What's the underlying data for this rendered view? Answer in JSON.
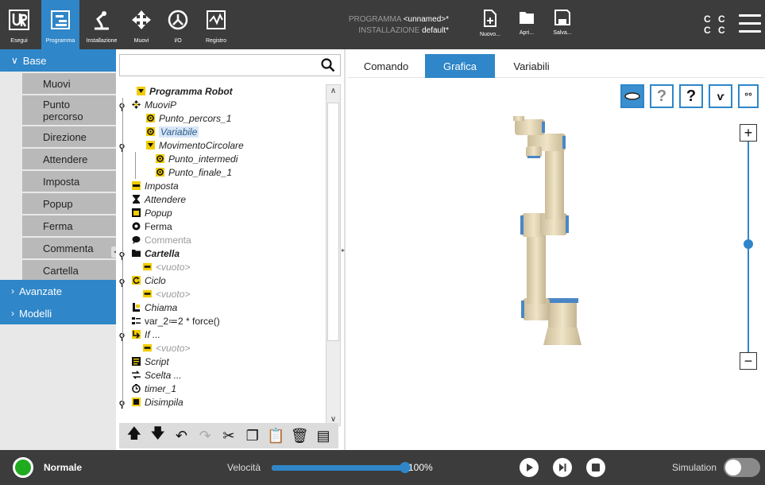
{
  "topbar": {
    "nav": [
      {
        "label": "Esegui",
        "icon": "ur-logo-icon"
      },
      {
        "label": "Programma",
        "icon": "program-tree-icon"
      },
      {
        "label": "Installazione",
        "icon": "robot-arm-icon"
      },
      {
        "label": "Muovi",
        "icon": "move-arrows-icon"
      },
      {
        "label": "I/O",
        "icon": "io-icon"
      },
      {
        "label": "Registro",
        "icon": "log-icon"
      }
    ],
    "program_key": "PROGRAMMA",
    "program_value": "<unnamed>*",
    "installation_key": "INSTALLAZIONE",
    "installation_value": "default*",
    "file_buttons": [
      {
        "label": "Nuovo...",
        "icon": "new-file-icon"
      },
      {
        "label": "Apri...",
        "icon": "folder-icon"
      },
      {
        "label": "Salva...",
        "icon": "save-icon"
      }
    ],
    "cc_line1": "C C",
    "cc_line2": "C C",
    "accent": "#2f86c8"
  },
  "palette": {
    "base_label": "Base",
    "items": [
      "Muovi",
      "Punto percorso",
      "Direzione",
      "Attendere",
      "Imposta",
      "Popup",
      "Ferma",
      "Commenta",
      "Cartella"
    ],
    "advanced_label": "Avanzate",
    "models_label": "Modelli"
  },
  "tree": {
    "search_placeholder": "",
    "nodes": [
      {
        "text": "Programma Robot",
        "icon": "flag-icon",
        "style": "bold it"
      },
      {
        "text": "MuoviP",
        "icon": "move-icon",
        "style": "it"
      },
      {
        "text": "Punto_percors_1",
        "icon": "waypoint-icon",
        "style": "it"
      },
      {
        "text": "Variabile",
        "icon": "waypoint-icon",
        "style": "it sel"
      },
      {
        "text": "MovimentoCircolare",
        "icon": "flag-icon",
        "style": "it"
      },
      {
        "text": "Punto_intermedi",
        "icon": "waypoint-icon",
        "style": "it"
      },
      {
        "text": "Punto_finale_1",
        "icon": "waypoint-icon",
        "style": "it"
      },
      {
        "text": "Imposta",
        "icon": "set-icon",
        "style": "it"
      },
      {
        "text": "Attendere",
        "icon": "hourglass-icon",
        "style": "it"
      },
      {
        "text": "Popup",
        "icon": "popup-icon",
        "style": "it"
      },
      {
        "text": "Ferma",
        "icon": "stop-icon",
        "style": ""
      },
      {
        "text": "Commenta",
        "icon": "comment-icon",
        "style": "gray"
      },
      {
        "text": "Cartella",
        "icon": "folder-icon",
        "style": "bold it"
      },
      {
        "text": "<vuoto>",
        "icon": "empty-icon",
        "style": "it gray"
      },
      {
        "text": "Ciclo",
        "icon": "loop-icon",
        "style": "it"
      },
      {
        "text": "<vuoto>",
        "icon": "empty-icon",
        "style": "it gray"
      },
      {
        "text": "Chiama",
        "icon": "call-icon",
        "style": "it"
      },
      {
        "text": "var_2≔2 * force()",
        "icon": "assignment-icon",
        "style": ""
      },
      {
        "text": "If ...",
        "icon": "if-icon",
        "style": "it"
      },
      {
        "text": "<vuoto>",
        "icon": "empty-icon",
        "style": "it gray"
      },
      {
        "text": "Script",
        "icon": "script-icon",
        "style": "it"
      },
      {
        "text": "Scelta ...",
        "icon": "switch-icon",
        "style": "it"
      },
      {
        "text": "timer_1",
        "icon": "timer-icon",
        "style": "it"
      },
      {
        "text": "Disimpila",
        "icon": "depalletize-icon",
        "style": "it"
      }
    ]
  },
  "tabs": [
    "Comando",
    "Grafica",
    "Variabili"
  ],
  "active_tab": "Grafica",
  "graphics": {
    "view_buttons": [
      "top-view-icon",
      "question-view-icon",
      "question-bold-view-icon",
      "path-view-icon",
      "waypoints-view-icon"
    ],
    "zoom_in": "+",
    "zoom_out": "−",
    "zoom_level": 0.5
  },
  "bottombar": {
    "mode": "Normale",
    "speed_label": "Velocità",
    "speed_value": "100%",
    "speed_fraction": 1.0,
    "simulation_label": "Simulation",
    "simulation_on": false,
    "status_color": "#1faa1f"
  }
}
